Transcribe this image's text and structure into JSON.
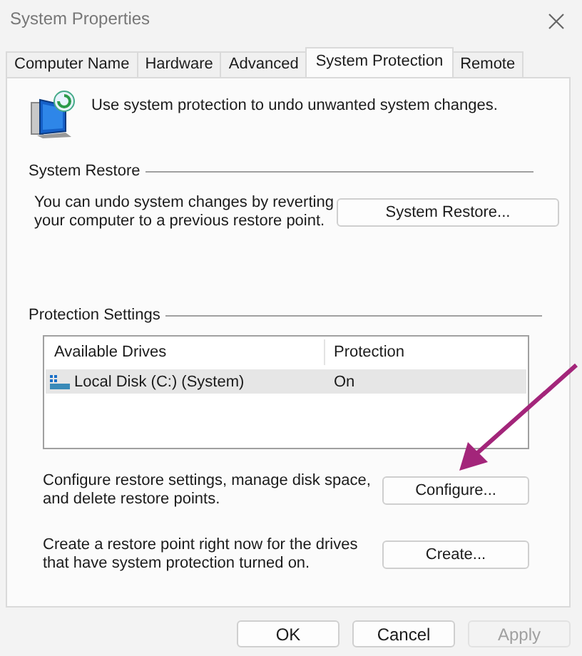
{
  "window": {
    "title": "System Properties"
  },
  "tabs": [
    {
      "label": "Computer Name",
      "selected": false
    },
    {
      "label": "Hardware",
      "selected": false
    },
    {
      "label": "Advanced",
      "selected": false
    },
    {
      "label": "System Protection",
      "selected": true
    },
    {
      "label": "Remote",
      "selected": false
    }
  ],
  "intro": "Use system protection to undo unwanted system changes.",
  "system_restore": {
    "heading": "System Restore",
    "description": "You can undo system changes by reverting your computer to a previous restore point.",
    "button": "System Restore..."
  },
  "protection_settings": {
    "heading": "Protection Settings",
    "columns": [
      "Available Drives",
      "Protection"
    ],
    "drives": [
      {
        "name": "Local Disk (C:) (System)",
        "protection": "On",
        "selected": true
      }
    ],
    "actions": [
      {
        "description": "Configure restore settings, manage disk space, and delete restore points.",
        "button": "Configure..."
      },
      {
        "description": "Create a restore point right now for the drives that have system protection turned on.",
        "button": "Create..."
      }
    ]
  },
  "buttons": [
    {
      "label": "OK",
      "disabled": false
    },
    {
      "label": "Cancel",
      "disabled": false
    },
    {
      "label": "Apply",
      "disabled": true
    }
  ]
}
